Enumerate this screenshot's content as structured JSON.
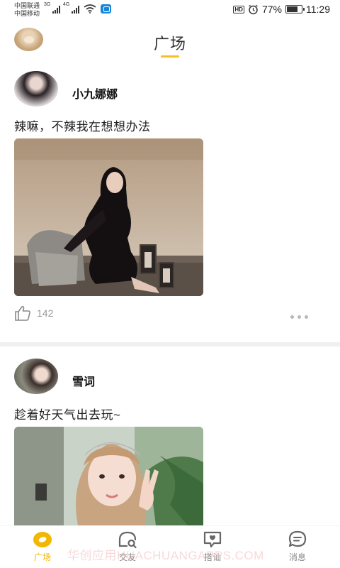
{
  "status_bar": {
    "carrier_1": "中国联通",
    "carrier_2": "中国移动",
    "signal_1": "3G",
    "signal_2": "4G",
    "hd": "HD",
    "battery": "77%",
    "battery_level": 0.77,
    "time": "11:29"
  },
  "header": {
    "title": "广场"
  },
  "posts": [
    {
      "username": "小九娜娜",
      "text": "辣嘛，不辣我在想想办法",
      "likes": "142"
    },
    {
      "username": "雪词",
      "text": "趁着好天气出去玩~"
    }
  ],
  "tabs": [
    {
      "label": "广场",
      "icon": "plaza-icon",
      "active": true
    },
    {
      "label": "交友",
      "icon": "friends-icon",
      "active": false
    },
    {
      "label": "搭讪",
      "icon": "chat-bubble-icon",
      "active": false
    },
    {
      "label": "消息",
      "icon": "message-icon",
      "active": false
    }
  ],
  "watermark": "华创应用HUACHUANGAPPS.COM",
  "colors": {
    "accent": "#f4c11f",
    "tab_active": "#f2b705",
    "tab_inactive": "#888888"
  }
}
